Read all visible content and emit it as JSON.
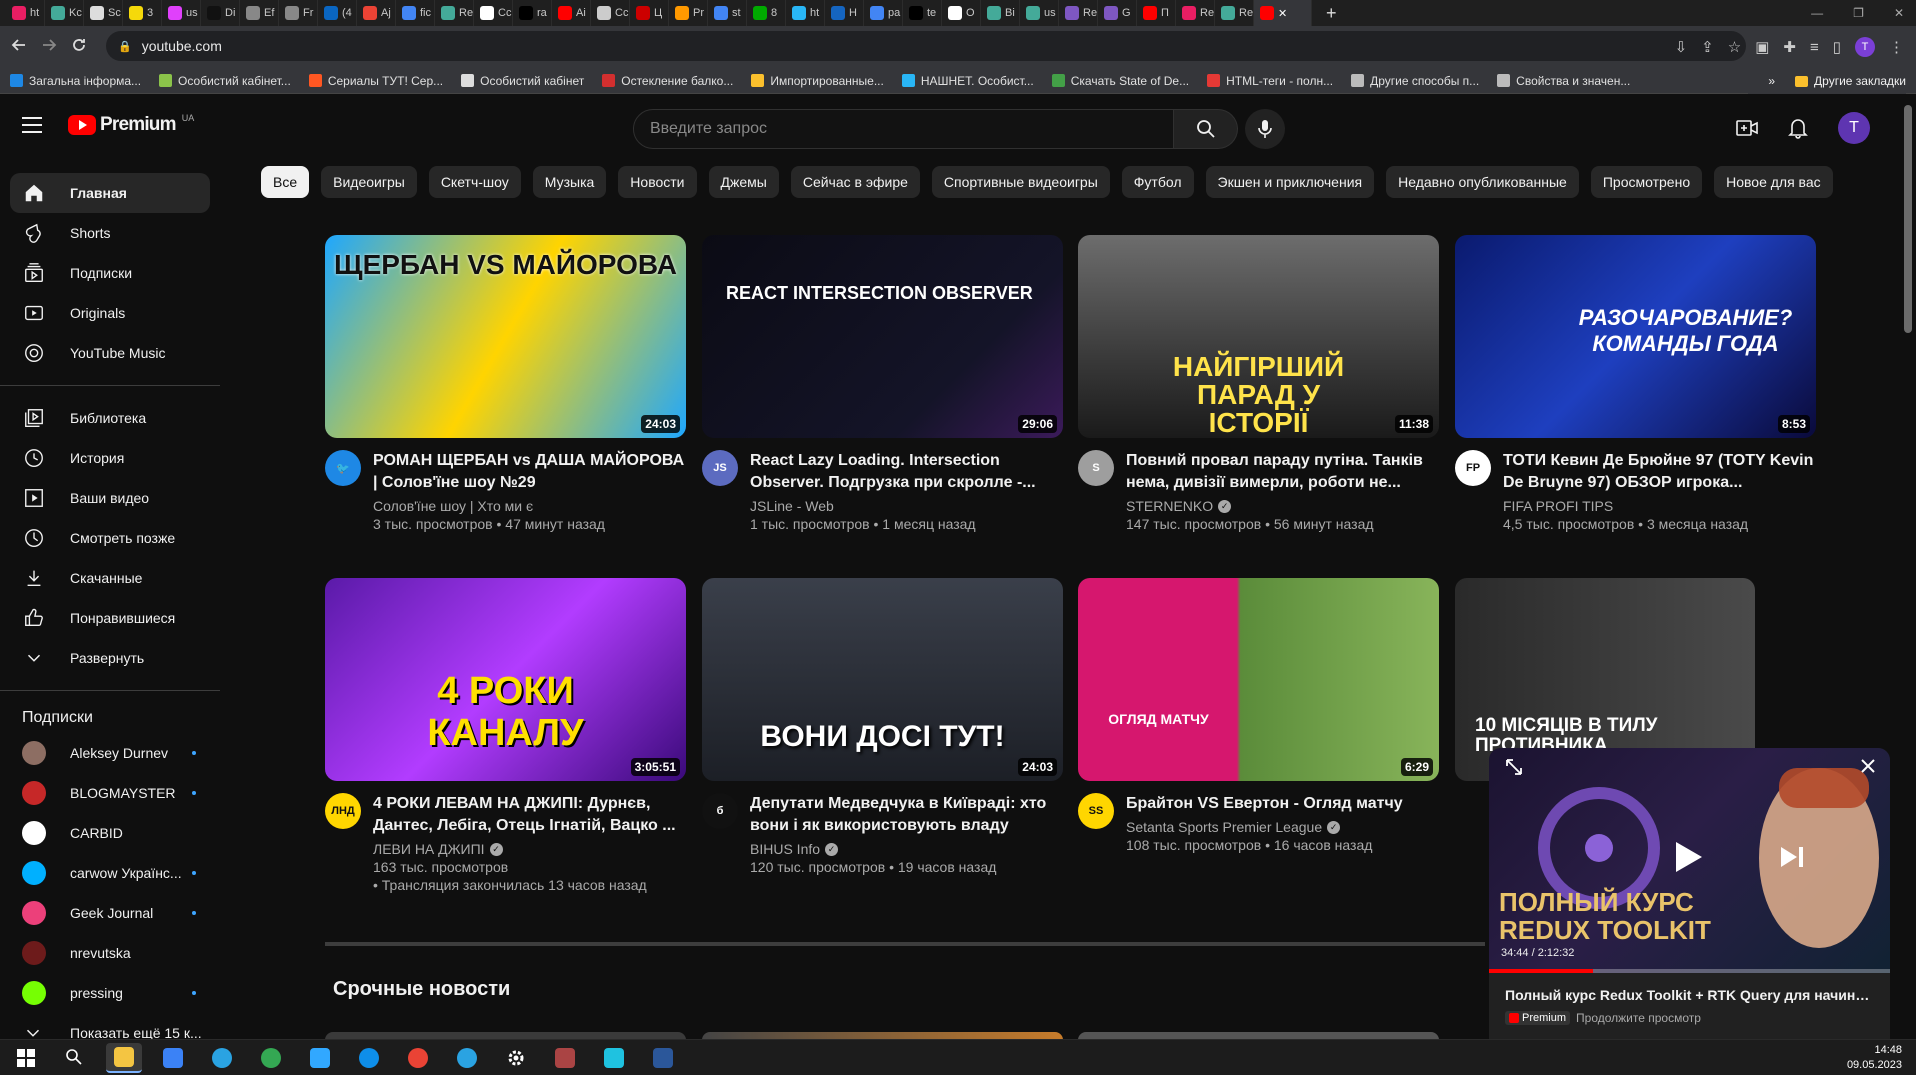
{
  "browser": {
    "tabs": [
      {
        "label": "ht",
        "color": "#e91e63"
      },
      {
        "label": "Kc",
        "color": "#4a9"
      },
      {
        "label": "Sc",
        "color": "#ddd"
      },
      {
        "label": "3",
        "color": "#f5d90a"
      },
      {
        "label": "us",
        "color": "#e040fb"
      },
      {
        "label": "Di",
        "color": "#111"
      },
      {
        "label": "Ef",
        "color": "#888"
      },
      {
        "label": "Fr",
        "color": "#888"
      },
      {
        "label": "(4",
        "color": "#0a66c2"
      },
      {
        "label": "Aj",
        "color": "#ea4335"
      },
      {
        "label": "fic",
        "color": "#4285f4"
      },
      {
        "label": "Re",
        "color": "#4a9"
      },
      {
        "label": "Cc",
        "color": "#fff"
      },
      {
        "label": "ra",
        "color": "#000"
      },
      {
        "label": "Ai",
        "color": "#ff0000"
      },
      {
        "label": "Cc",
        "color": "#ccc"
      },
      {
        "label": "Ц",
        "color": "#c00"
      },
      {
        "label": "Pr",
        "color": "#f90"
      },
      {
        "label": "st",
        "color": "#4285f4"
      },
      {
        "label": "8",
        "color": "#0a0"
      },
      {
        "label": "ht",
        "color": "#29b6f6"
      },
      {
        "label": "H",
        "color": "#1565c0"
      },
      {
        "label": "pa",
        "color": "#4285f4"
      },
      {
        "label": "te",
        "color": "#000"
      },
      {
        "label": "O",
        "color": "#fff"
      },
      {
        "label": "Bi",
        "color": "#4a9"
      },
      {
        "label": "us",
        "color": "#4a9"
      },
      {
        "label": "Re",
        "color": "#7e57c2"
      },
      {
        "label": "G",
        "color": "#7e57c2"
      },
      {
        "label": "П",
        "color": "#ff0000"
      },
      {
        "label": "Re",
        "color": "#e91e63"
      },
      {
        "label": "Re",
        "color": "#4a9"
      }
    ],
    "active_tab": {
      "label": "✕",
      "color": "#ff0000"
    },
    "new_tab": "+",
    "window_controls": [
      "—",
      "❐",
      "✕"
    ],
    "url": "youtube.com",
    "bookmarks": [
      {
        "label": "Загальна інформа...",
        "color": "#1e88e5"
      },
      {
        "label": "Особистий кабінет...",
        "color": "#8bc34a"
      },
      {
        "label": "Сериалы ТУТ! Сер...",
        "color": "#ff5722"
      },
      {
        "label": "Особистий кабінет",
        "color": "#ddd"
      },
      {
        "label": "Остекление балко...",
        "color": "#d32f2f"
      },
      {
        "label": "Импортированные...",
        "color": "#fbc02d"
      },
      {
        "label": "НАШНЕТ. Особист...",
        "color": "#29b6f6"
      },
      {
        "label": "Скачать State of De...",
        "color": "#43a047"
      },
      {
        "label": "HTML-теги - полн...",
        "color": "#e53935"
      },
      {
        "label": "Другие способы п...",
        "color": "#bbb"
      },
      {
        "label": "Свойства и значен...",
        "color": "#bbb"
      }
    ],
    "bookmarks_overflow": "»",
    "other_bookmarks": "Другие закладки"
  },
  "header": {
    "logo_text": "Premium",
    "country": "UA",
    "search_placeholder": "Введите запрос",
    "avatar_letter": "T"
  },
  "sidebar": {
    "main": [
      {
        "label": "Главная",
        "icon": "home-icon"
      },
      {
        "label": "Shorts",
        "icon": "shorts-icon"
      },
      {
        "label": "Подписки",
        "icon": "subscriptions-icon"
      },
      {
        "label": "Originals",
        "icon": "originals-icon"
      },
      {
        "label": "YouTube Music",
        "icon": "music-icon"
      }
    ],
    "library": [
      {
        "label": "Библиотека",
        "icon": "library-icon"
      },
      {
        "label": "История",
        "icon": "history-icon"
      },
      {
        "label": "Ваши видео",
        "icon": "your-videos-icon"
      },
      {
        "label": "Смотреть позже",
        "icon": "watch-later-icon"
      },
      {
        "label": "Скачанные",
        "icon": "download-icon"
      },
      {
        "label": "Понравившиеся",
        "icon": "like-icon"
      },
      {
        "label": "Развернуть",
        "icon": "chevron-down-icon"
      }
    ],
    "subs_heading": "Подписки",
    "subscriptions": [
      {
        "name": "Aleksey Durnev",
        "color": "#8d6e63",
        "new": true
      },
      {
        "name": "BLOGMAYSTER",
        "color": "#c62828",
        "new": true
      },
      {
        "name": "CARBID",
        "color": "#ffffff",
        "new": false
      },
      {
        "name": "carwow Українс...",
        "color": "#00b0ff",
        "new": true
      },
      {
        "name": "Geek Journal",
        "color": "#ec407a",
        "new": true
      },
      {
        "name": "nrevutska",
        "color": "#6d1b1b",
        "new": false
      },
      {
        "name": "pressing",
        "color": "#76ff03",
        "new": true
      }
    ],
    "show_more": "Показать ещё 15 к..."
  },
  "chips": [
    "Все",
    "Видеоигры",
    "Скетч-шоу",
    "Музыка",
    "Новости",
    "Джемы",
    "Сейчас в эфире",
    "Спортивные видеоигры",
    "Футбол",
    "Экшен и приключения",
    "Недавно опубликованные",
    "Просмотрено",
    "Новое для вас"
  ],
  "videos": [
    {
      "title": "РОМАН ЩЕРБАН vs ДАША МАЙОРОВА | Солов'їне шоу №29",
      "channel": "Солов'їне шоу | Хто ми є",
      "verified": false,
      "stats": "3 тыс. просмотров • 47 минут назад",
      "extra": "",
      "duration": "24:03",
      "thumb_text": "ЩЕРБАН  VS  МАЙОРОВА",
      "bg": "linear-gradient(120deg,#1ea7ff 0%,#ffd400 50%,#1ea7ff 100%)",
      "avatar_color": "#1e88e5",
      "avatar_text": "🐦"
    },
    {
      "title": "React Lazy Loading. Intersection Observer. Подгрузка при скролле -...",
      "channel": "JSLine - Web",
      "verified": false,
      "stats": "1 тыс. просмотров • 1 месяц назад",
      "extra": "",
      "duration": "29:06",
      "thumb_text": "REACT INTERSECTION OBSERVER",
      "bg": "linear-gradient(135deg,#0b0b14 0%,#141428 70%,#3b1a5a 100%)",
      "avatar_color": "#5c6bc0",
      "avatar_text": "JS"
    },
    {
      "title": "Повний провал параду путіна. Танків нема, дивізії вимерли, роботи не...",
      "channel": "STERNENKO",
      "verified": true,
      "stats": "147 тыс. просмотров • 56 минут назад",
      "extra": "",
      "duration": "11:38",
      "thumb_text": "НАЙГІРШИЙ ПАРАД У ІСТОРІЇ",
      "bg": "linear-gradient(180deg,#6d6d6d 0%,#3a3a3a 60%,#1a1a1a 100%)",
      "avatar_color": "#9e9e9e",
      "avatar_text": "S"
    },
    {
      "title": "ТОТИ Кевин Де Брюйне 97 (TOTY Kevin De Bruyne 97) ОБЗОР игрока...",
      "channel": "FIFA PROFI TIPS",
      "verified": false,
      "stats": "4,5 тыс. просмотров • 3 месяца назад",
      "extra": "",
      "duration": "8:53",
      "thumb_text": "РАЗОЧАРОВАНИЕ? КОМАНДЫ ГОДА",
      "bg": "linear-gradient(135deg,#0a1a6e 0%,#1e3fbf 50%,#0a0a3a 100%)",
      "avatar_color": "#ffffff",
      "avatar_text": "FP"
    },
    {
      "title": "4 РОКИ ЛЕВАМ НА ДЖИПІ: Дурнєв, Дантес, Лебіга, Отець Ігнатій, Вацко ...",
      "channel": "ЛЕВИ НА ДЖИПІ",
      "verified": true,
      "stats": "163 тыс. просмотров",
      "extra": "• Трансляция закончилась 13 часов назад",
      "duration": "3:05:51",
      "thumb_text": "4 РОКИ КАНАЛУ",
      "bg": "linear-gradient(135deg,#5a1aa8 0%,#b23cff 50%,#3a0a7a 100%)",
      "avatar_color": "#ffd600",
      "avatar_text": "ЛНД"
    },
    {
      "title": "Депутати Медведчука в Київраді: хто вони і як використовують владу",
      "channel": "BIHUS Info",
      "verified": true,
      "stats": "120 тыс. просмотров • 19 часов назад",
      "extra": "",
      "duration": "24:03",
      "thumb_text": "ВОНИ ДОСІ ТУТ!",
      "bg": "linear-gradient(180deg,#3a3f4a 0%,#1c1f26 100%)",
      "avatar_color": "#111111",
      "avatar_text": "б"
    },
    {
      "title": "Брайтон VS Евертон - Огляд матчу",
      "channel": "Setanta Sports Premier League",
      "verified": true,
      "stats": "108 тыс. просмотров • 16 часов назад",
      "extra": "",
      "duration": "6:29",
      "thumb_text": "ОГЛЯД МАТЧУ",
      "bg": "linear-gradient(90deg,#d6176e 0%,#d6176e 44%,#5b8c3a 45%,#88b45a 100%)",
      "avatar_color": "#ffd600",
      "avatar_text": "SS"
    },
    {
      "title": "",
      "channel": "",
      "verified": false,
      "stats": "",
      "extra": "",
      "duration": "",
      "thumb_text": "10 МІСЯЦІВ В ТИЛУ ПРОТИВНИКА",
      "bg": "linear-gradient(90deg,#2a2a2a 0%,#4a4a4a 100%)",
      "avatar_color": "#555",
      "avatar_text": ""
    }
  ],
  "shelf": {
    "title": "Срочные новости"
  },
  "miniplayer": {
    "time": "34:44 / 2:12:32",
    "progress": 0.26,
    "thumb_text": "ПОЛНЫЙ КУРС REDUX TOOLKIT",
    "title": "Полный курс Redux Toolkit + RTK Query для начинающ...",
    "badge": "Premium",
    "subtitle": "Продолжите просмотр"
  },
  "taskbar": {
    "time": "14:48",
    "date": "09.05.2023",
    "apps": [
      {
        "name": "start-icon",
        "color": "#ffffff"
      },
      {
        "name": "search-icon",
        "color": "#ffffff"
      },
      {
        "name": "explorer-icon",
        "color": "#f4c542",
        "active": true
      },
      {
        "name": "store-icon",
        "color": "#3b82f6"
      },
      {
        "name": "telegram-icon",
        "color": "#2aa3e2"
      },
      {
        "name": "chrome-icon",
        "color": "#34a853"
      },
      {
        "name": "photoshop-icon",
        "color": "#31a8ff"
      },
      {
        "name": "edge-icon",
        "color": "#0e8ee9"
      },
      {
        "name": "chrome-icon-2",
        "color": "#ea4335"
      },
      {
        "name": "telegram-icon-2",
        "color": "#2aa3e2"
      },
      {
        "name": "settings-icon",
        "color": "#ffffff"
      },
      {
        "name": "winrar-icon",
        "color": "#a44"
      },
      {
        "name": "webstorm-icon",
        "color": "#1fc2e0"
      },
      {
        "name": "word-icon",
        "color": "#2b579a"
      }
    ]
  }
}
